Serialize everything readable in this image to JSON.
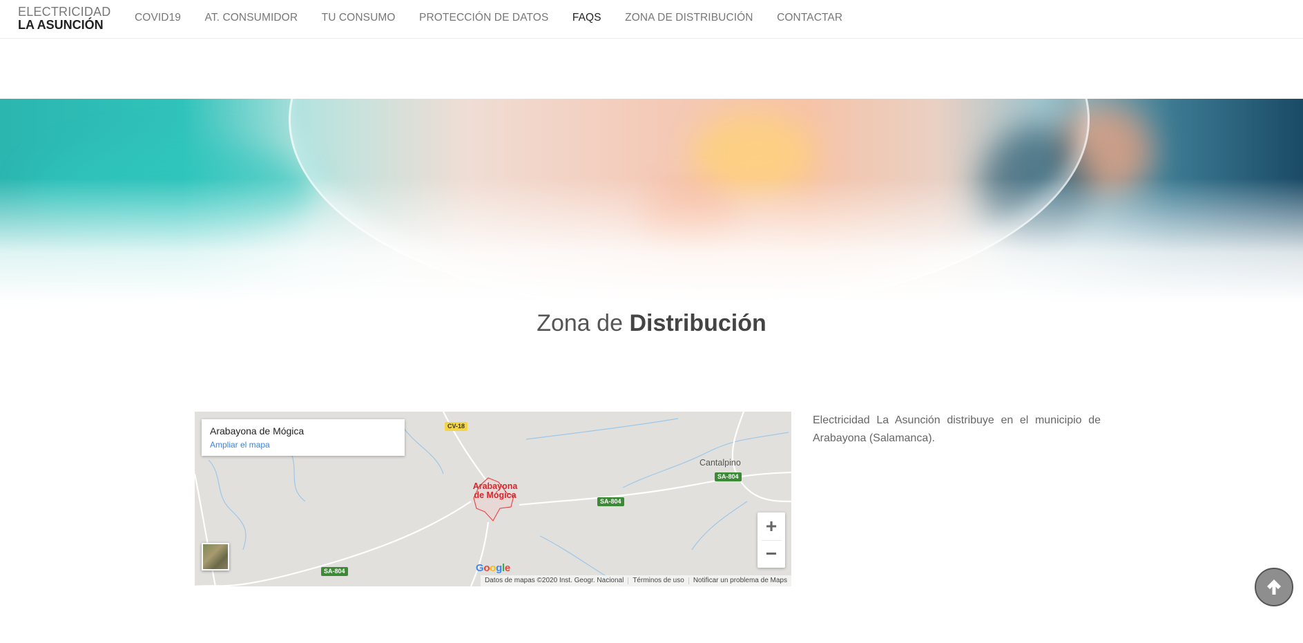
{
  "header": {
    "logo_top": "ELECTRICIDAD",
    "logo_bottom": "LA ASUNCIÓN",
    "nav": [
      {
        "label": "COVID19"
      },
      {
        "label": "AT. CONSUMIDOR"
      },
      {
        "label": "TU CONSUMO"
      },
      {
        "label": "PROTECCIÓN DE DATOS"
      },
      {
        "label": "FAQS",
        "active": true
      },
      {
        "label": "ZONA DE DISTRIBUCIÓN"
      },
      {
        "label": "CONTACTAR"
      }
    ]
  },
  "title": {
    "light": "Zona de ",
    "bold": "Distribución"
  },
  "map": {
    "place_name": "Arabayona de Mógica",
    "expand_link": "Ampliar el mapa",
    "center_label_line1": "Arabayona",
    "center_label_line2": "de Mógica",
    "town_cantalpino": "Cantalpino",
    "roads": {
      "cv18": "CV-18",
      "sa804": "SA-804"
    },
    "zoom_in": "+",
    "zoom_out": "−",
    "google": "Google",
    "attribution": [
      "Datos de mapas ©2020 Inst. Geogr. Nacional",
      "Términos de uso",
      "Notificar un problema de Maps"
    ]
  },
  "description": "Electricidad La Asunción distribuye en el municipio de Arabayona (Salamanca).",
  "icons": {
    "scroll_top": "arrow-up-icon",
    "layer": "satellite-layer-icon"
  },
  "colors": {
    "active_nav": "#222222",
    "nav": "#777777",
    "map_link": "#3a84df",
    "town_red": "#d7262b",
    "road_green": "#3d8a36"
  }
}
